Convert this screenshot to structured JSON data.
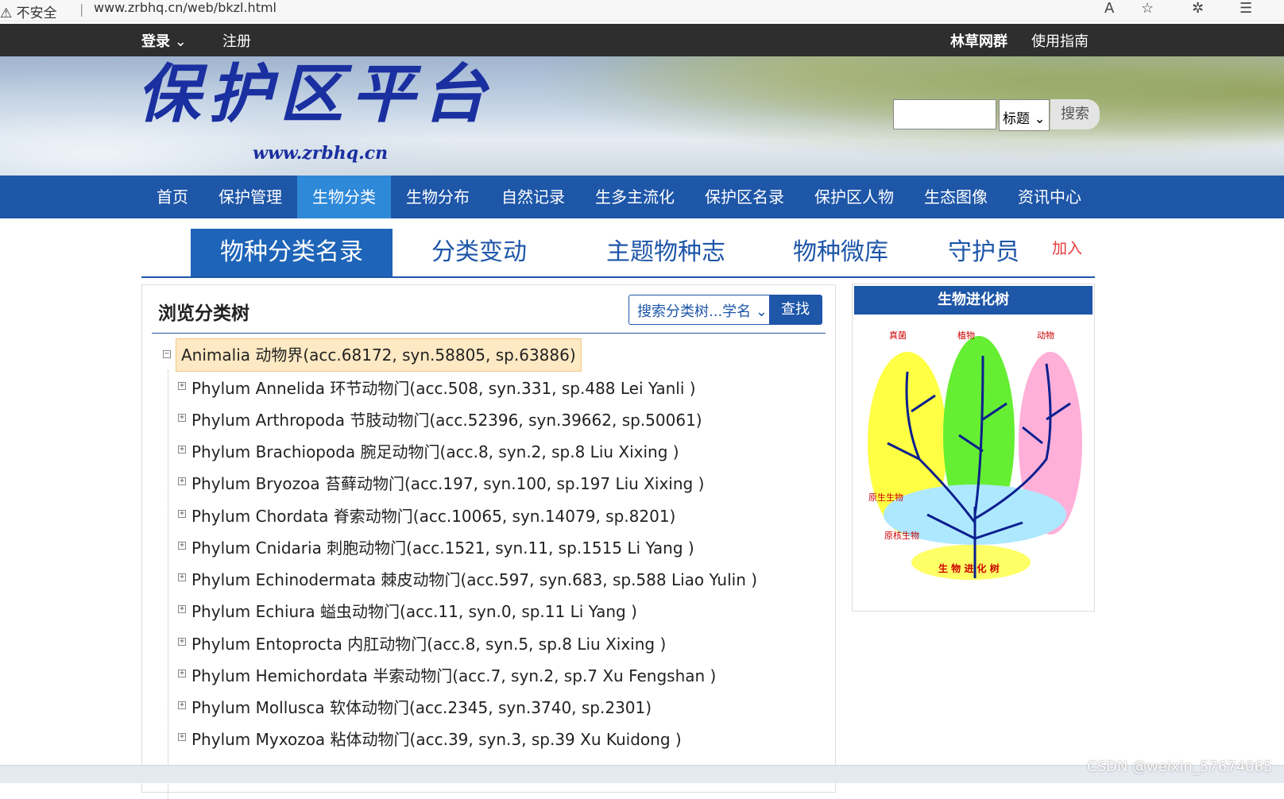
{
  "browser": {
    "security_label": "不安全",
    "url": "www.zrbhq.cn/web/bkzl.html"
  },
  "topbar": {
    "login": "登录",
    "register": "注册",
    "forest_group": "林草网群",
    "guide": "使用指南"
  },
  "header": {
    "logo_text": "保护区平台",
    "logo_url": "www.zrbhq.cn",
    "search": {
      "input_value": "",
      "select_value": "标题",
      "button_label": "搜索"
    }
  },
  "nav": {
    "items": [
      "首页",
      "保护管理",
      "生物分类",
      "生物分布",
      "自然记录",
      "生多主流化",
      "保护区名录",
      "保护区人物",
      "生态图像",
      "资讯中心"
    ],
    "active_index": 2
  },
  "tabs": {
    "items": [
      "物种分类名录",
      "分类变动",
      "主题物种志",
      "物种微库",
      "守护员"
    ],
    "join": "加入",
    "active_index": 0
  },
  "tree_panel": {
    "title": "浏览分类树",
    "search_select": "搜索分类树...学名",
    "search_button": "查找",
    "root": "Animalia 动物界(acc.68172, syn.58805, sp.63886)",
    "nodes": [
      "Phylum Annelida 环节动物门(acc.508, syn.331, sp.488 Lei Yanli )",
      "Phylum Arthropoda 节肢动物门(acc.52396, syn.39662, sp.50061)",
      "Phylum Brachiopoda 腕足动物门(acc.8, syn.2, sp.8 Liu Xixing )",
      "Phylum Bryozoa 苔藓动物门(acc.197, syn.100, sp.197 Liu Xixing )",
      "Phylum Chordata 脊索动物门(acc.10065, syn.14079, sp.8201)",
      "Phylum Cnidaria 刺胞动物门(acc.1521, syn.11, sp.1515 Li Yang )",
      "Phylum Echinodermata 棘皮动物门(acc.597, syn.683, sp.588 Liao Yulin )",
      "Phylum Echiura 螠虫动物门(acc.11, syn.0, sp.11 Li Yang )",
      "Phylum Entoprocta 内肛动物门(acc.8, syn.5, sp.8 Liu Xixing )",
      "Phylum Hemichordata 半索动物门(acc.7, syn.2, sp.7 Xu Fengshan )",
      "Phylum Mollusca 软体动物门(acc.2345, syn.3740, sp.2301)",
      "Phylum Myxozoa 粘体动物门(acc.39, syn.3, sp.39 Xu Kuidong )"
    ]
  },
  "evolution_panel": {
    "title": "生物进化树",
    "labels": {
      "fungi": "真菌",
      "plants": "植物",
      "animals": "动物",
      "protists": "原生生物",
      "prokaryotes": "原核生物",
      "caption": "生 物 进 化 树"
    }
  },
  "watermark": "CSDN @weixin_57674065",
  "colors": {
    "nav_bg": "#1e56a8",
    "nav_active": "#2e89d8",
    "topbar_bg": "#2e2e2e",
    "tree_root_bg": "#fde9c3",
    "join_red": "#e83a3a"
  }
}
